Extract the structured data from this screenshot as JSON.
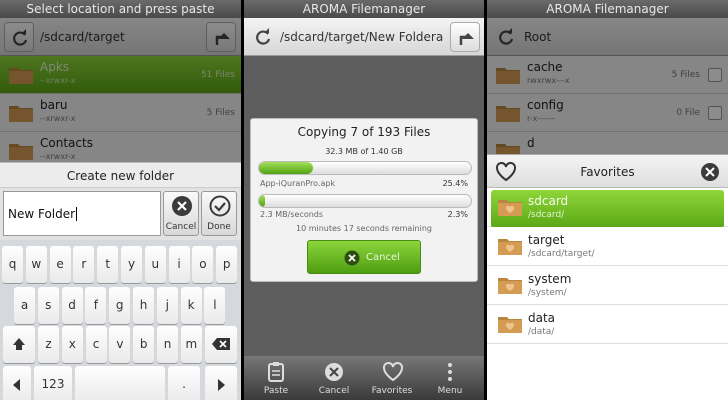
{
  "panel1": {
    "title": "Select location and press paste",
    "path": "/sdcard/target",
    "files": [
      {
        "name": "Apks",
        "perm": "--xrwxr-x",
        "count": "51 Files"
      },
      {
        "name": "baru",
        "perm": "--xrwxr-x",
        "count": "5 Files"
      },
      {
        "name": "Contacts",
        "perm": "--xrwxr-x",
        "count": ""
      }
    ],
    "dialog_title": "Create new folder",
    "input_value": "New Folder",
    "cancel_label": "Cancel",
    "done_label": "Done",
    "keyboard": {
      "row1": [
        "q",
        "w",
        "e",
        "r",
        "t",
        "y",
        "u",
        "i",
        "o",
        "p"
      ],
      "row2": [
        "a",
        "s",
        "d",
        "f",
        "g",
        "h",
        "j",
        "k",
        "l"
      ],
      "row3": [
        "z",
        "x",
        "c",
        "v",
        "b",
        "n",
        "m"
      ],
      "num_label": "123",
      "period": "."
    }
  },
  "panel2": {
    "title": "AROMA Filemanager",
    "path": "/sdcard/target/New Foldera",
    "progress_title": "Copying 7 of 193 Files",
    "progress_size": "32.3 MB of 1.40 GB",
    "file_name": "App-iQuranPro.apk",
    "file_pct_label": "25.4%",
    "file_progress": 0.254,
    "total_progress": 0.023,
    "speed": "2.3 MB/seconds",
    "total_pct_label": "2.3%",
    "remaining": "10 minutes 17 seconds remaining",
    "cancel_label": "Cancel",
    "bottom": [
      "Paste",
      "Cancel",
      "Favorites",
      "Menu"
    ]
  },
  "panel3": {
    "title": "AROMA Filemanager",
    "path": "Root",
    "files": [
      {
        "name": "cache",
        "perm": "rwxrwx---x",
        "count": "5 Files"
      },
      {
        "name": "config",
        "perm": "r-x------",
        "count": "0 File"
      },
      {
        "name": "d",
        "perm": "",
        "count": ""
      }
    ],
    "favorites_title": "Favorites",
    "favorites": [
      {
        "name": "sdcard",
        "path": "/sdcard/"
      },
      {
        "name": "target",
        "path": "/sdcard/target/"
      },
      {
        "name": "system",
        "path": "/system/"
      },
      {
        "name": "data",
        "path": "/data/"
      }
    ]
  },
  "colors": {
    "accent_green": "#6ab820",
    "folder": "#d49b52"
  }
}
